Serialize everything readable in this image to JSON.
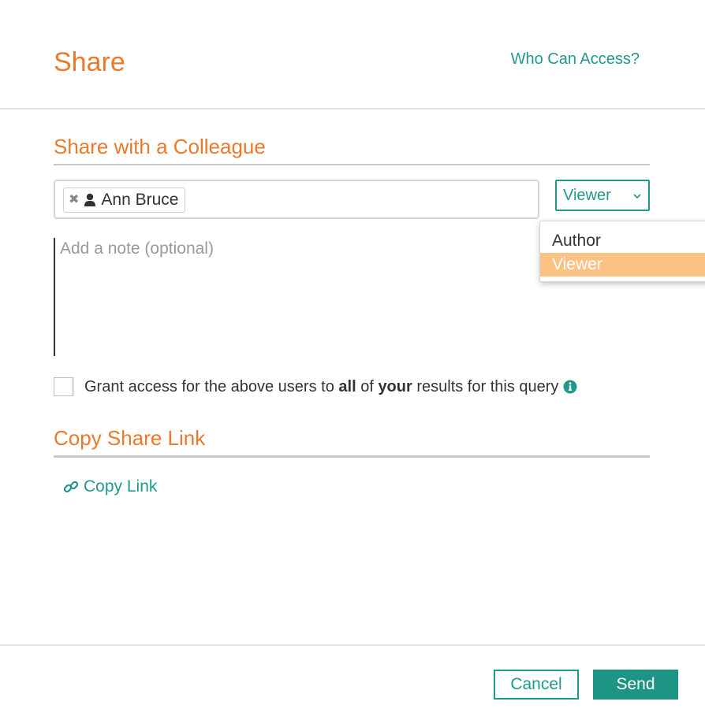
{
  "header": {
    "title": "Share",
    "who_can_access": "Who Can Access?"
  },
  "share_section": {
    "title": "Share with a Colleague",
    "recipients": [
      {
        "name": "Ann Bruce",
        "remove_icon": "close-icon",
        "icon": "user-icon"
      }
    ],
    "role_select": {
      "value": "Viewer",
      "options": [
        "Author",
        "Viewer"
      ],
      "selected_option": "Viewer"
    },
    "note": {
      "placeholder": "Add a note (optional)",
      "value": ""
    },
    "grant_access": {
      "checked": false,
      "text_1": "Grant access for the above users to ",
      "text_all": "all",
      "text_2": " of ",
      "text_your": "your",
      "text_3": " results for this query"
    }
  },
  "copy_section": {
    "title": "Copy Share Link",
    "copy_link_label": "Copy Link"
  },
  "footer": {
    "cancel_label": "Cancel",
    "send_label": "Send"
  },
  "colors": {
    "accent_orange": "#e97a2c",
    "accent_teal": "#20998b",
    "selected_option_bg": "#fac384"
  }
}
